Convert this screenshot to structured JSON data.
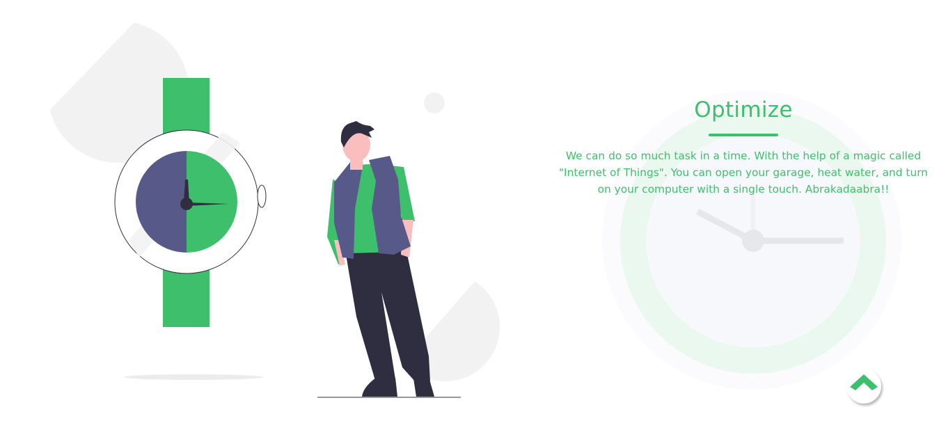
{
  "feature": {
    "title": "Optimize",
    "description": "We can do so much task in a time. With the help of a magic called \"Internet of Things\". You can open your garage, heat water, and turn on your computer with a single touch. Abrakadaabra!!"
  },
  "scroll_top": {
    "icon": "chevron-up-icon"
  },
  "colors": {
    "accent": "#3dbf6b",
    "navy": "#575a89",
    "dark": "#2f2e41",
    "skin": "#fbbebe",
    "light_gray": "#f2f2f2"
  }
}
